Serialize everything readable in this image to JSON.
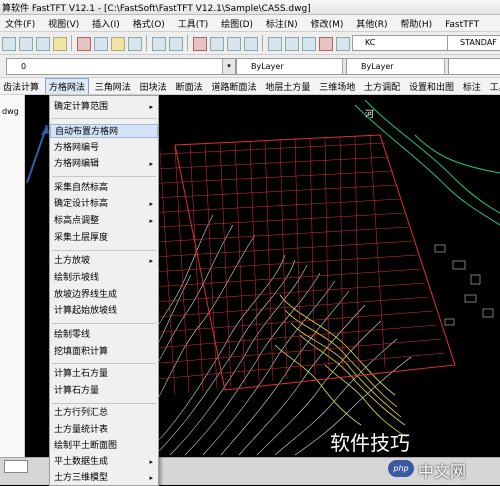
{
  "window": {
    "title": "算软件 FastTFT V12.1 - [C:\\FastSoft\\FastTFT V12.1\\Sample\\CASS.dwg]"
  },
  "menubar": {
    "items": [
      "文件(F)",
      "视图(V)",
      "插入(I)",
      "格式(O)",
      "工具(T)",
      "绘图(D)",
      "标注(N)",
      "修改(M)",
      "其他(R)",
      "帮助(H)",
      "FastTFT"
    ]
  },
  "toolbar": {
    "style_combo": "KC",
    "text_style_combo": "STANDAF",
    "layer_value": "0",
    "linetype_value": "ByLayer",
    "lineweight_value": "ByLayer"
  },
  "left_panel": {
    "label": "dwg"
  },
  "function_toolbar": {
    "items": [
      "齿法计算",
      "方格网法",
      "三角网法",
      "田块法",
      "断面法",
      "道路断面法",
      "地层土方量",
      "三维场地",
      "土方调配",
      "设置和出图",
      "标注",
      "工具",
      "帮"
    ],
    "active": "方格网法"
  },
  "dropdown_menu": {
    "items": [
      {
        "label": "确定计算范围",
        "has_submenu": true
      },
      {
        "label": "自动布置方格网",
        "highlighted": true
      },
      {
        "label": "方格网编号"
      },
      {
        "label": "方格网编辑",
        "has_submenu": true
      },
      {
        "label": "采集自然标高"
      },
      {
        "label": "确定设计标高",
        "has_submenu": true
      },
      {
        "label": "标高点调整",
        "has_submenu": true
      },
      {
        "label": "采集土层厚度"
      },
      {
        "label": "土方放坡",
        "has_submenu": true
      },
      {
        "label": "绘制示坡线"
      },
      {
        "label": "放坡边界线生成"
      },
      {
        "label": "计算起始放坡线"
      },
      {
        "label": "绘制零线"
      },
      {
        "label": "挖填面积计算"
      },
      {
        "label": "计算土石方量"
      },
      {
        "label": "计算石方量"
      },
      {
        "label": "土方行列汇总"
      },
      {
        "label": "土方量统计表"
      },
      {
        "label": "绘制平土断面图"
      },
      {
        "label": "平土数据生成",
        "has_submenu": true
      },
      {
        "label": "土方三维模型",
        "has_submenu": true
      }
    ]
  },
  "icons": {
    "submenu_arrow": "▸",
    "combo_arrow": "▾",
    "canvas_label": "河"
  },
  "watermark": {
    "text": "软件技巧",
    "logo_badge": "php",
    "logo_text": "中文网"
  },
  "colors": {
    "canvas_bg": "#000000",
    "grid_line": "#e03030",
    "contour_white": "#dcdcdc",
    "contour_yellow": "#e6e63a",
    "road_green": "#22c47a",
    "menu_highlight": "#d5e3f6",
    "annotation_arrow": "#2f5fa8"
  }
}
